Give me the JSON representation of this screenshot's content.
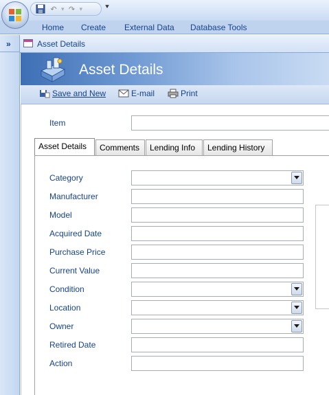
{
  "quick_access": {
    "save_icon": "save-icon",
    "undo_icon": "undo-icon",
    "redo_icon": "redo-icon",
    "customize_icon": "customize-qat-icon"
  },
  "ribbon": {
    "tabs": [
      "Home",
      "Create",
      "External Data",
      "Database Tools"
    ]
  },
  "nav_pane": {
    "toggle_label": "»"
  },
  "document_tab": {
    "title": "Asset Details"
  },
  "form_header": {
    "title": "Asset Details"
  },
  "toolbar": {
    "save_new": "Save and New",
    "email": "E-mail",
    "print": "Print"
  },
  "item": {
    "label": "Item",
    "value": ""
  },
  "tabs": [
    "Asset Details",
    "Comments",
    "Lending Info",
    "Lending History"
  ],
  "fields": [
    {
      "label": "Category",
      "type": "combo",
      "value": ""
    },
    {
      "label": "Manufacturer",
      "type": "text",
      "value": ""
    },
    {
      "label": "Model",
      "type": "text",
      "value": ""
    },
    {
      "label": "Acquired Date",
      "type": "text",
      "value": ""
    },
    {
      "label": "Purchase Price",
      "type": "text",
      "value": ""
    },
    {
      "label": "Current Value",
      "type": "text",
      "value": ""
    },
    {
      "label": "Condition",
      "type": "combo",
      "value": ""
    },
    {
      "label": "Location",
      "type": "combo",
      "value": ""
    },
    {
      "label": "Owner",
      "type": "combo",
      "value": ""
    },
    {
      "label": "Retired Date",
      "type": "text",
      "value": ""
    },
    {
      "label": "Action",
      "type": "text",
      "value": ""
    }
  ]
}
